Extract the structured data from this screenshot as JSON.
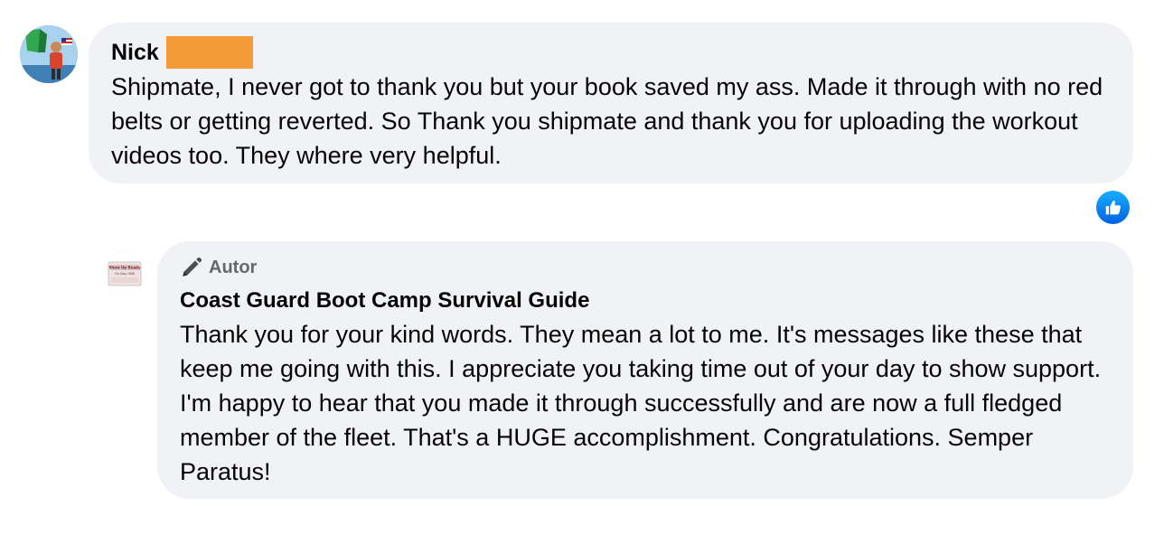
{
  "comments": [
    {
      "author": "Nick",
      "text": "Shipmate, I never got to thank you but your book saved my ass. Made it through with no red belts or getting reverted. So Thank you shipmate and thank you for uploading the workout videos too. They where very helpful.",
      "reaction_icon": "like-icon"
    }
  ],
  "reply": {
    "role_label": "Autor",
    "role_icon": "pencil-icon",
    "author": "Coast Guard Boot Camp Survival Guide",
    "text": "Thank you for your kind words. They mean a lot to me. It's messages like these that keep me going with this. I appreciate you taking time out of your day to show support. I'm happy to hear that you made it through successfully and are now a full fledged member of the fleet. That's a HUGE accomplishment. Congratulations. Semper Paratus!",
    "avatar_text": "Show Up Ready On Day ONE"
  },
  "colors": {
    "bubble_bg": "#f0f2f5",
    "redaction": "#f29b37",
    "like_blue": "#0062df",
    "secondary_text": "#65676b"
  }
}
